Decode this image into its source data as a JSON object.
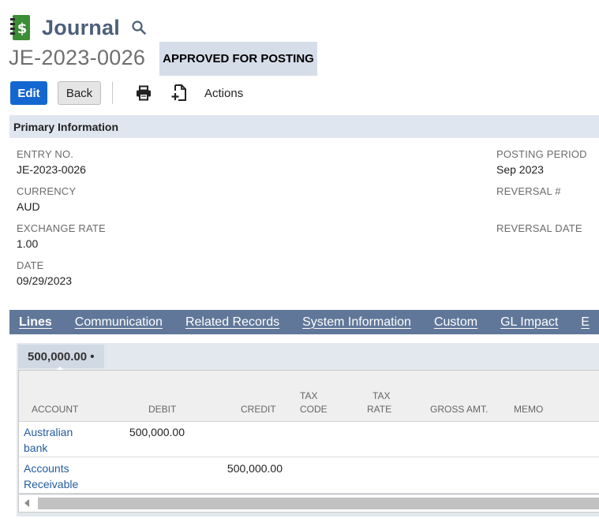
{
  "header": {
    "title": "Journal",
    "icon": "journal-dollar-icon",
    "icon_color": "#3b8d36",
    "search_icon": "search-icon",
    "record_number": "JE-2023-0026",
    "status": "APPROVED FOR POSTING"
  },
  "toolbar": {
    "edit_label": "Edit",
    "back_label": "Back",
    "print_icon": "print-icon",
    "new_doc_icon": "new-document-icon",
    "actions_label": "Actions",
    "edit_color": "#1467d1"
  },
  "primary": {
    "section_title": "Primary Information",
    "entry_no_label": "ENTRY NO.",
    "entry_no": "JE-2023-0026",
    "currency_label": "CURRENCY",
    "currency": "AUD",
    "exchange_rate_label": "EXCHANGE RATE",
    "exchange_rate": "1.00",
    "date_label": "DATE",
    "date": "09/29/2023",
    "posting_period_label": "POSTING PERIOD",
    "posting_period": "Sep 2023",
    "reversal_no_label": "REVERSAL #",
    "reversal_date_label": "REVERSAL DATE"
  },
  "tabs": [
    {
      "label": "Lines"
    },
    {
      "label": "Communication"
    },
    {
      "label": "Related Records"
    },
    {
      "label": "System Information"
    },
    {
      "label": "Custom"
    },
    {
      "label": "GL Impact"
    },
    {
      "label": "E"
    }
  ],
  "lines": {
    "subtab_label": "500,000.00 •",
    "columns": {
      "account": "ACCOUNT",
      "debit": "DEBIT",
      "credit": "CREDIT",
      "tax_code_1": "TAX",
      "tax_code_2": "CODE",
      "tax_rate_1": "TAX",
      "tax_rate_2": "RATE",
      "gross_amt": "GROSS AMT.",
      "memo": "MEMO"
    },
    "rows": [
      {
        "account_1": "Australian",
        "account_2": "bank",
        "debit": "500,000.00",
        "credit": ""
      },
      {
        "account_1": "Accounts",
        "account_2": "Receivable",
        "debit": "",
        "credit": "500,000.00"
      }
    ]
  }
}
